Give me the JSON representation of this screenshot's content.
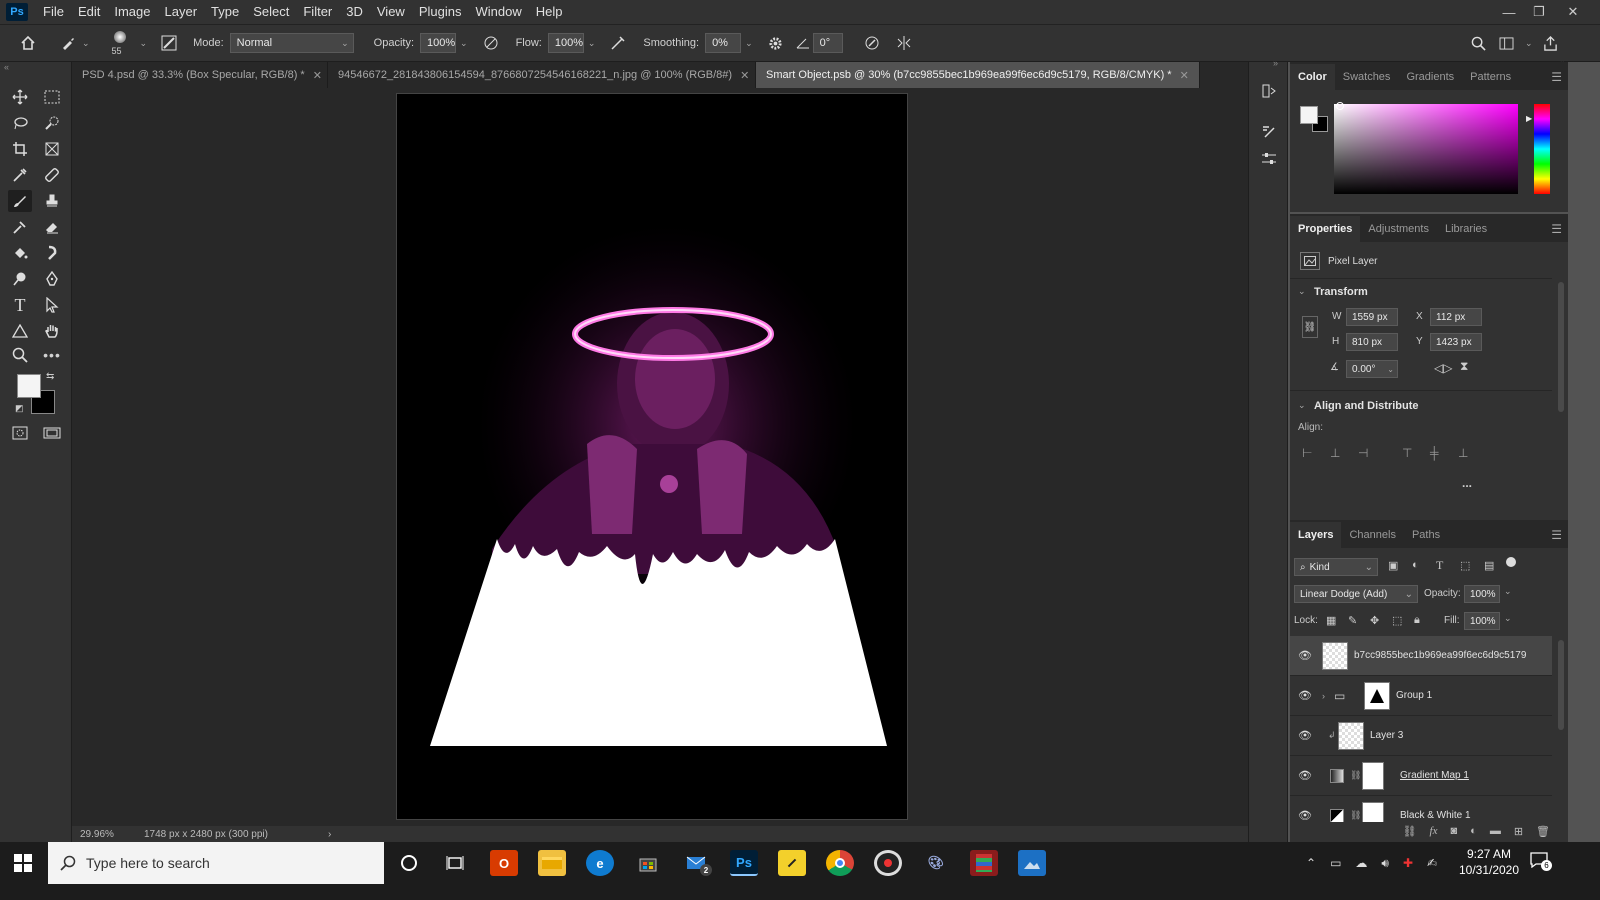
{
  "app": {
    "logo": "Ps"
  },
  "menu": [
    "File",
    "Edit",
    "Image",
    "Layer",
    "Type",
    "Select",
    "Filter",
    "3D",
    "View",
    "Plugins",
    "Window",
    "Help"
  ],
  "window_controls": {
    "minimize": "—",
    "restore": "❐",
    "close": "✕"
  },
  "options": {
    "brush_size": "55",
    "mode_label": "Mode:",
    "mode_value": "Normal",
    "opacity_label": "Opacity:",
    "opacity_value": "100%",
    "flow_label": "Flow:",
    "flow_value": "100%",
    "smoothing_label": "Smoothing:",
    "smoothing_value": "0%",
    "angle_value": "0°"
  },
  "tabs": [
    {
      "label": "PSD 4.psd @ 33.3% (Box Specular, RGB/8) *",
      "active": false
    },
    {
      "label": "94546672_281843806154594_8766807254546168221_n.jpg @ 100% (RGB/8#)",
      "active": false
    },
    {
      "label": "Smart Object.psb @ 30% (b7cc9855bec1b969ea99f6ec6d9c5179, RGB/8/CMYK) *",
      "active": true
    }
  ],
  "status": {
    "zoom": "29.96%",
    "doc_info": "1748 px x 2480 px (300 ppi)",
    "arrow": "›"
  },
  "color_panel": {
    "tabs": [
      "Color",
      "Swatches",
      "Gradients",
      "Patterns"
    ]
  },
  "properties": {
    "tabs": [
      "Properties",
      "Adjustments",
      "Libraries"
    ],
    "kind": "Pixel Layer",
    "transform_title": "Transform",
    "w_label": "W",
    "w_value": "1559 px",
    "h_label": "H",
    "h_value": "810 px",
    "x_label": "X",
    "x_value": "112 px",
    "y_label": "Y",
    "y_value": "1423 px",
    "angle_value": "0.00°",
    "align_title": "Align and Distribute",
    "align_label": "Align:",
    "more": "..."
  },
  "layers": {
    "tabs": [
      "Layers",
      "Channels",
      "Paths"
    ],
    "filter": "Kind",
    "blend_mode": "Linear Dodge (Add)",
    "opacity_label": "Opacity:",
    "opacity_value": "100%",
    "lock_label": "Lock:",
    "fill_label": "Fill:",
    "fill_value": "100%",
    "items": [
      {
        "name": "b7cc9855bec1b969ea99f6ec6d9c5179"
      },
      {
        "name": "Group 1"
      },
      {
        "name": "Layer 3"
      },
      {
        "name": "Gradient Map 1"
      },
      {
        "name": "Black & White 1"
      }
    ]
  },
  "taskbar": {
    "search_placeholder": "Type here to search",
    "mail_badge": "2",
    "photoshop_label": "Ps",
    "time": "9:27 AM",
    "date": "10/31/2020",
    "notification_count": "6"
  }
}
